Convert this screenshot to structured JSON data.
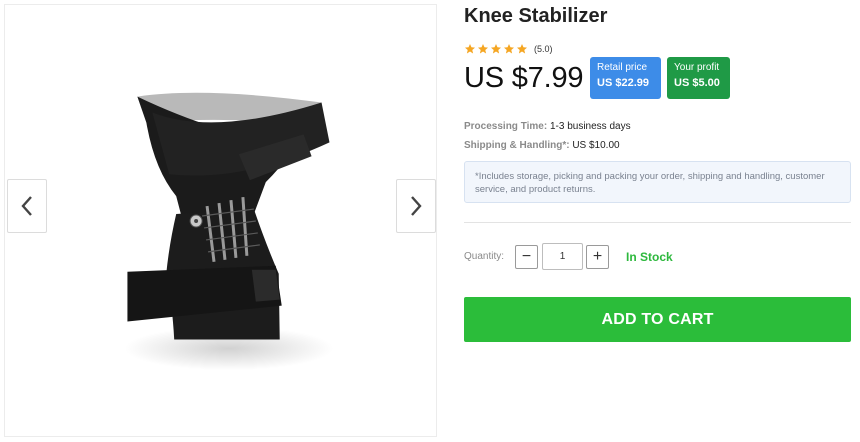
{
  "gallery": {
    "prev_icon": "chevron-left-icon",
    "next_icon": "chevron-right-icon"
  },
  "product": {
    "title": "Knee Stabilizer",
    "rating": {
      "stars": 5,
      "text": "(5.0)",
      "star_color": "#f5a623"
    },
    "price": "US $7.99",
    "retail": {
      "label": "Retail price",
      "value": "US $22.99",
      "color": "#3d8ce8"
    },
    "profit": {
      "label": "Your profit",
      "value": "US $5.00",
      "color": "#1f9a46"
    },
    "processing": {
      "label": "Processing Time:",
      "value": "1-3 business days"
    },
    "shipping": {
      "label": "Shipping & Handling*:",
      "value": "US $10.00"
    },
    "note": "*Includes storage, picking and packing your order, shipping and handling, customer service, and product returns."
  },
  "purchase": {
    "quantity_label": "Quantity:",
    "quantity": "1",
    "minus": "−",
    "plus": "+",
    "stock": "In Stock",
    "add_to_cart": "ADD TO CART",
    "accent": "#2bbd3a"
  }
}
